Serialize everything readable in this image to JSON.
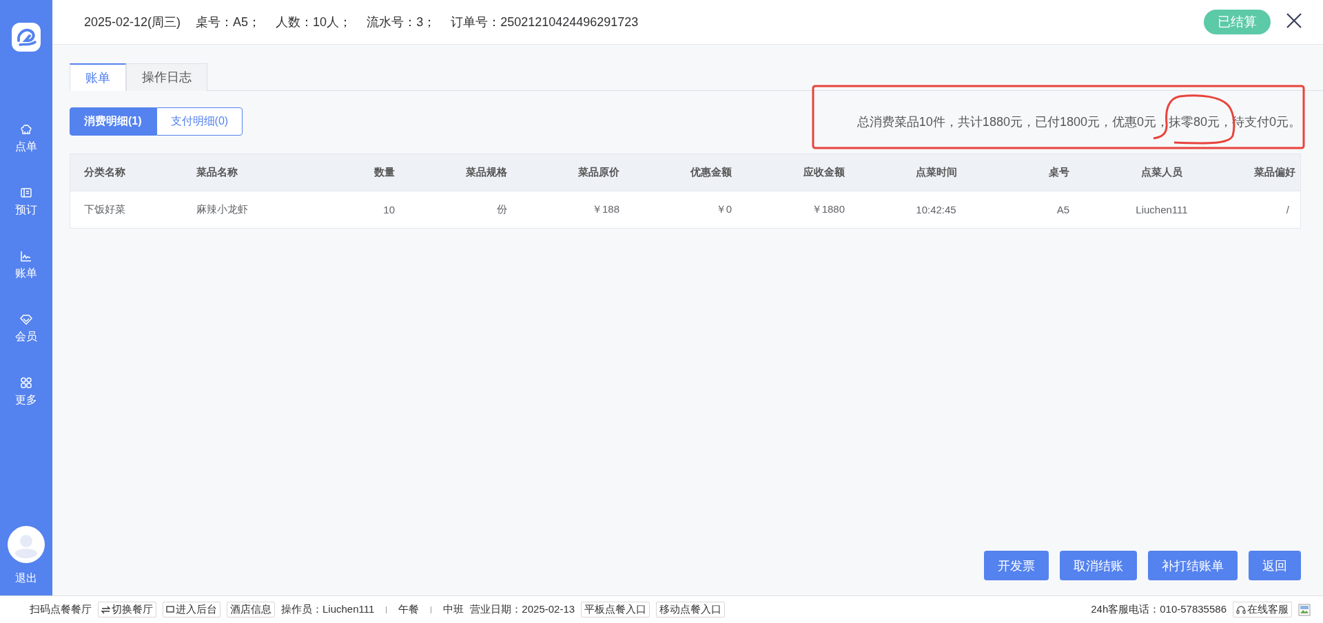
{
  "sidebar": {
    "items": [
      {
        "label": "点单"
      },
      {
        "label": "预订"
      },
      {
        "label": "账单"
      },
      {
        "label": "会员"
      },
      {
        "label": "更多"
      }
    ],
    "logout": "退出"
  },
  "header": {
    "fields": [
      "2025-02-12(周三)",
      "桌号：A5；",
      "人数：10人；",
      "流水号：3；",
      "订单号：25021210424496291723"
    ],
    "status": "已结算"
  },
  "tabs": [
    {
      "label": "账单",
      "selected": true
    },
    {
      "label": "操作日志",
      "selected": false
    }
  ],
  "sub_tabs": [
    {
      "label": "消费明细(1)",
      "selected": true
    },
    {
      "label": "支付明细(0)",
      "selected": false
    }
  ],
  "summary": "总消费菜品10件，共计1880元，已付1800元，优惠0元，抹零80元，待支付0元。",
  "table": {
    "columns": [
      "分类名称",
      "菜品名称",
      "数量",
      "菜品规格",
      "菜品原价",
      "优惠金额",
      "应收金额",
      "点菜时间",
      "桌号",
      "点菜人员",
      "菜品偏好"
    ],
    "rows": [
      [
        "下饭好菜",
        "麻辣小龙虾",
        "10",
        "份",
        "￥188",
        "￥0",
        "￥1880",
        "10:42:45",
        "A5",
        "Liuchen111",
        "/"
      ]
    ]
  },
  "buttons": [
    "开发票",
    "取消结账",
    "补打结账单",
    "返回"
  ],
  "status_bar": {
    "left": [
      {
        "kind": "text",
        "label": "扫码点餐餐厅"
      },
      {
        "kind": "swap",
        "label": "切换餐厅"
      },
      {
        "kind": "panel",
        "label": "进入后台"
      },
      {
        "kind": "button",
        "label": "酒店信息"
      },
      {
        "kind": "text",
        "label": "操作员：Liuchen111"
      },
      {
        "kind": "divider"
      },
      {
        "kind": "text",
        "label": "午餐"
      },
      {
        "kind": "divider"
      },
      {
        "kind": "text",
        "label": "中班"
      },
      {
        "kind": "text",
        "label": "营业日期：2025-02-13"
      },
      {
        "kind": "button",
        "label": "平板点餐入口"
      },
      {
        "kind": "button",
        "label": "移动点餐入口"
      }
    ],
    "right": [
      {
        "kind": "text",
        "label": "24h客服电话：010-57835586"
      },
      {
        "kind": "headset",
        "label": "在线客服"
      },
      {
        "kind": "image"
      }
    ]
  }
}
